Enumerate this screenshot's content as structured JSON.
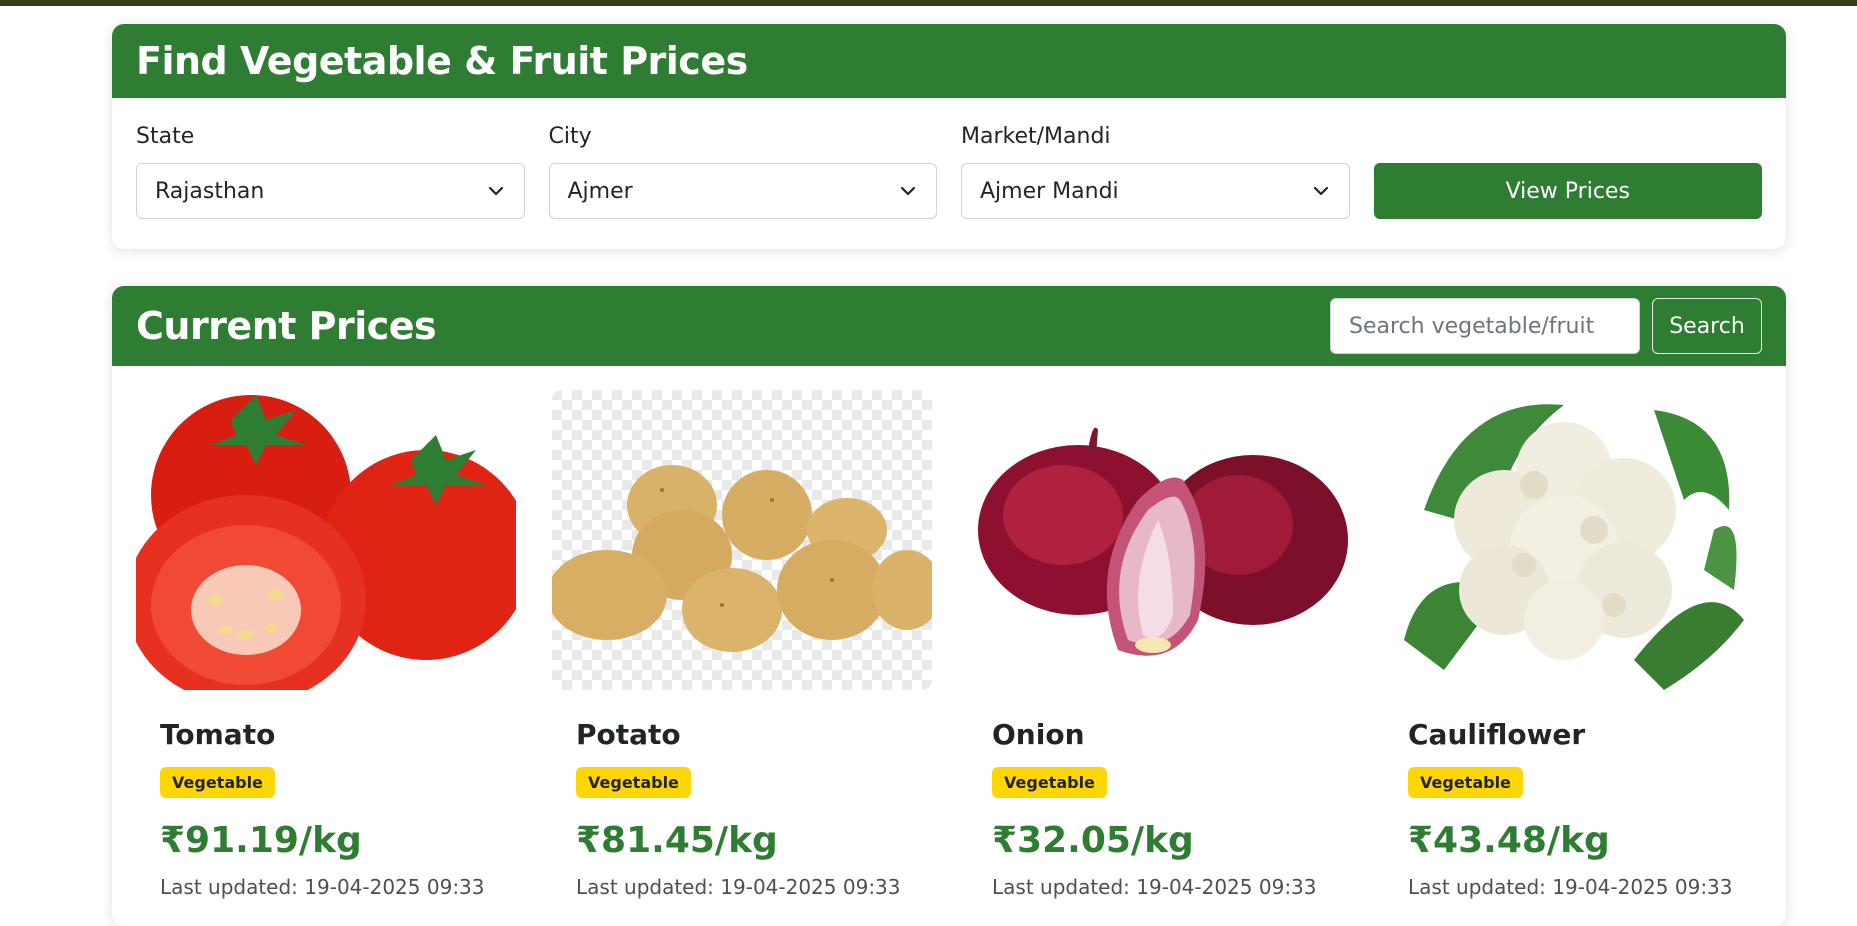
{
  "filter": {
    "title": "Find Vegetable & Fruit Prices",
    "state_label": "State",
    "state_value": "Rajasthan",
    "city_label": "City",
    "city_value": "Ajmer",
    "market_label": "Market/Mandi",
    "market_value": "Ajmer Mandi",
    "view_button": "View Prices"
  },
  "prices": {
    "title": "Current Prices",
    "search_placeholder": "Search vegetable/fruit",
    "search_button": "Search",
    "items": [
      {
        "name": "Tomato",
        "category": "Vegetable",
        "price": "₹91.19/kg",
        "updated": "Last updated: 19-04-2025 09:33",
        "image": "tomato-image"
      },
      {
        "name": "Potato",
        "category": "Vegetable",
        "price": "₹81.45/kg",
        "updated": "Last updated: 19-04-2025 09:33",
        "image": "potato-image"
      },
      {
        "name": "Onion",
        "category": "Vegetable",
        "price": "₹32.05/kg",
        "updated": "Last updated: 19-04-2025 09:33",
        "image": "onion-image"
      },
      {
        "name": "Cauliflower",
        "category": "Vegetable",
        "price": "₹43.48/kg",
        "updated": "Last updated: 19-04-2025 09:33",
        "image": "cauliflower-image"
      }
    ]
  },
  "colors": {
    "primary": "#2e7d32",
    "badge": "#ffd600",
    "top_strip": "#3d3a1c"
  }
}
